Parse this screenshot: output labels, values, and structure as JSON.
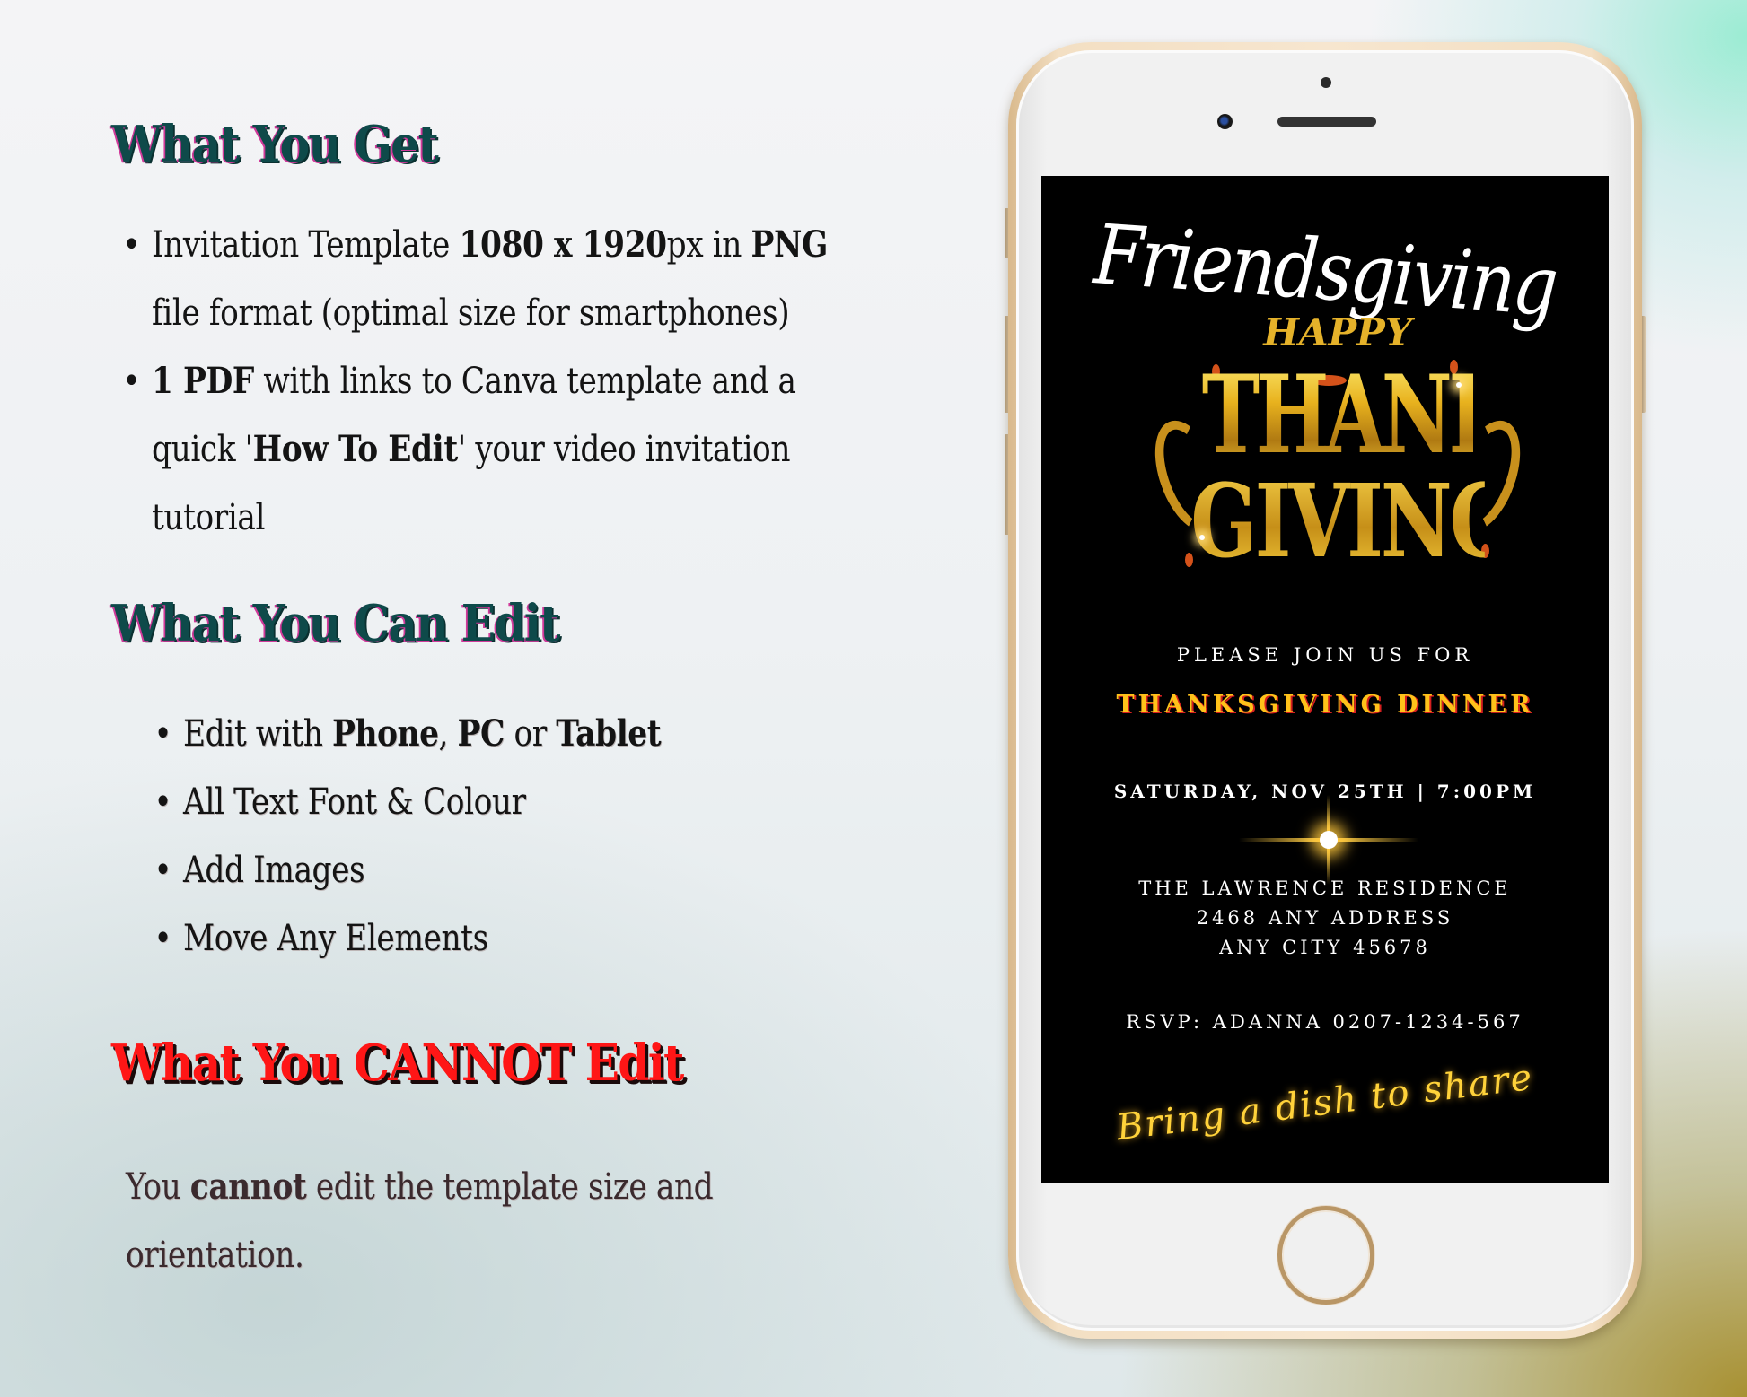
{
  "sections": {
    "get": {
      "heading": "What You Get",
      "items": [
        {
          "line1": {
            "t1": "Invitation Template ",
            "b1": "1080 x 1920",
            "t2": "px in ",
            "b2": "PNG"
          },
          "line2": "file format (optimal size for smartphones)"
        },
        {
          "line1": {
            "b1": "1 PDF",
            "t1": " with links to Canva template and a"
          },
          "line2": {
            "t1": "quick  '",
            "b1": "How To Edit",
            "t2": "' your video invitation"
          },
          "line3": "tutorial"
        }
      ]
    },
    "can_edit": {
      "heading": "What You Can Edit",
      "items": [
        {
          "t1": "Edit with ",
          "b1": "Phone",
          "t2": ", ",
          "b2": "PC",
          "t3": " or ",
          "b3": "Tablet"
        },
        {
          "text": "All Text Font & Colour"
        },
        {
          "text": "Add Images"
        },
        {
          "text": "Move Any Elements"
        }
      ]
    },
    "cannot_edit": {
      "heading": "What You CANNOT Edit",
      "paragraph": {
        "t1": "You ",
        "b1": "cannot",
        "t2": " edit the template size and",
        "line2": "orientation."
      }
    }
  },
  "bullet": "•",
  "invitation": {
    "script_title": "Friendsgiving",
    "art": {
      "happy": "HAPPY",
      "thanks": "THANKS",
      "giving": "GIVING"
    },
    "please_join": "PLEASE JOIN US FOR",
    "event": "THANKSGIVING DINNER",
    "datetime": "SATURDAY, NOV 25TH | 7:00PM",
    "address": [
      "THE LAWRENCE RESIDENCE",
      "2468 ANY ADDRESS",
      "ANY CITY 45678"
    ],
    "rsvp": "RSVP: ADANNA 0207-1234-567",
    "note": "Bring a dish to share"
  },
  "colors": {
    "heading_teal": "#0e4a4a",
    "heading_red": "#ff1616",
    "event_gold": "#ffc21a",
    "note_gold": "#ffd23a",
    "phone_frame_gold": "#f3dfc3"
  }
}
